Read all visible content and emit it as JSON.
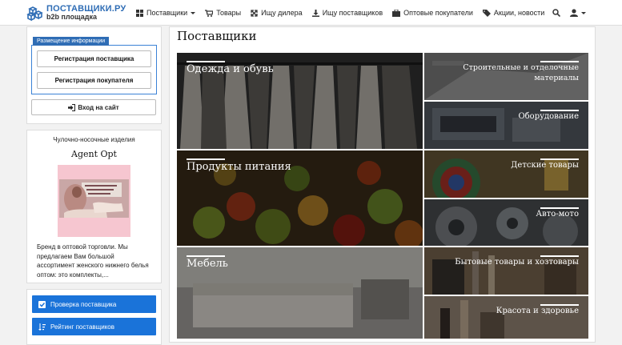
{
  "header": {
    "logo_title": "ПОСТАВЩИКИ.РУ",
    "logo_sub": "b2b площадка",
    "nav": [
      {
        "label": "Поставщики",
        "icon": "grid-icon",
        "dropdown": true
      },
      {
        "label": "Товары",
        "icon": "cart-icon"
      },
      {
        "label": "Ищу дилера",
        "icon": "expand-arrows-icon"
      },
      {
        "label": "Ищу поставщиков",
        "icon": "download-icon"
      },
      {
        "label": "Оптовые покупатели",
        "icon": "briefcase-icon"
      },
      {
        "label": "Акции, новости",
        "icon": "tag-icon"
      }
    ]
  },
  "sidebar": {
    "reg_legend": "Размещение информации",
    "reg_supplier": "Регистрация поставщика",
    "reg_buyer": "Регистрация покупателя",
    "login": "Вход на сайт",
    "ad": {
      "category": "Чулочно-носочные изделия",
      "name": "Agent Opt",
      "description": "Бренд в оптовой торговли. Мы предлагаем Вам большой ассортимент женского нижнего белья оптом: это комплекты,..."
    },
    "check_supplier": "Проверка поставщика",
    "rating_suppliers": "Рейтинг поставщиков"
  },
  "main": {
    "title": "Поставщики",
    "categories": [
      {
        "label": "Одежда и обувь"
      },
      {
        "label": "Строительные и отделочные материалы"
      },
      {
        "label": "Оборудование"
      },
      {
        "label": "Продукты питания"
      },
      {
        "label": "Детские товары"
      },
      {
        "label": "Авто-мото"
      },
      {
        "label": "Мебель"
      },
      {
        "label": "Бытовые товары и хозтовары"
      },
      {
        "label": "Красота и здоровье"
      }
    ]
  },
  "colors": {
    "brand_blue": "#2f6db5",
    "button_blue": "#1a73d9"
  }
}
